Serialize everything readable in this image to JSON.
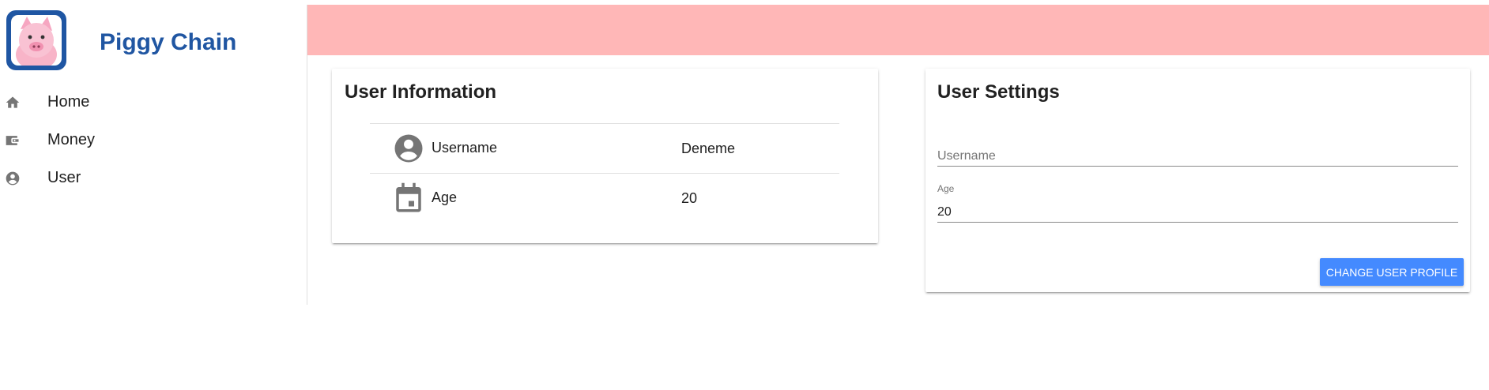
{
  "app": {
    "title": "Piggy Chain"
  },
  "sidebar": {
    "items": [
      {
        "label": "Home",
        "icon": "home-icon"
      },
      {
        "label": "Money",
        "icon": "wallet-icon"
      },
      {
        "label": "User",
        "icon": "account-circle-icon"
      }
    ]
  },
  "colors": {
    "brand": "#2056a2",
    "topbar": "#ffb7b7",
    "button": "#448aff",
    "icon": "#757575"
  },
  "user_info": {
    "title": "User Information",
    "rows": [
      {
        "key": "Username",
        "value": "Deneme",
        "icon": "account-circle-icon"
      },
      {
        "key": "Age",
        "value": "20",
        "icon": "calendar-icon"
      }
    ]
  },
  "user_settings": {
    "title": "User Settings",
    "username_placeholder": "Username",
    "age_label": "Age",
    "age_value": "20",
    "button_label": "CHANGE USER PROFILE"
  }
}
